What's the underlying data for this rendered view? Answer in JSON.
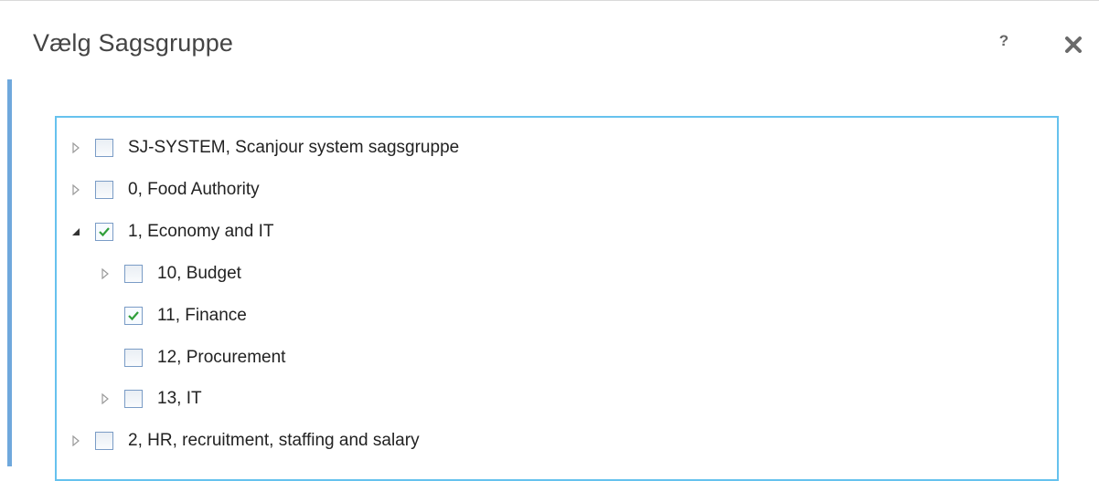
{
  "dialog": {
    "title": "Vælg Sagsgruppe",
    "help_label": "?",
    "close_icon": "close-icon"
  },
  "tree": {
    "items": [
      {
        "label": "SJ-SYSTEM, Scanjour system sagsgruppe",
        "level": 0,
        "expander": "collapsed",
        "checked": false
      },
      {
        "label": "0, Food Authority",
        "level": 0,
        "expander": "collapsed",
        "checked": false
      },
      {
        "label": "1, Economy and IT",
        "level": 0,
        "expander": "expanded",
        "checked": true
      },
      {
        "label": "10, Budget",
        "level": 1,
        "expander": "collapsed",
        "checked": false
      },
      {
        "label": "11, Finance",
        "level": 1,
        "expander": "none",
        "checked": true
      },
      {
        "label": "12, Procurement",
        "level": 1,
        "expander": "none",
        "checked": false
      },
      {
        "label": "13, IT",
        "level": 1,
        "expander": "collapsed",
        "checked": false
      },
      {
        "label": "2, HR, recruitment, staffing and salary",
        "level": 0,
        "expander": "collapsed",
        "checked": false
      }
    ]
  },
  "colors": {
    "accent": "#6fa8dc",
    "tree_border": "#66c2ee",
    "checkmark": "#2e9e3a"
  }
}
